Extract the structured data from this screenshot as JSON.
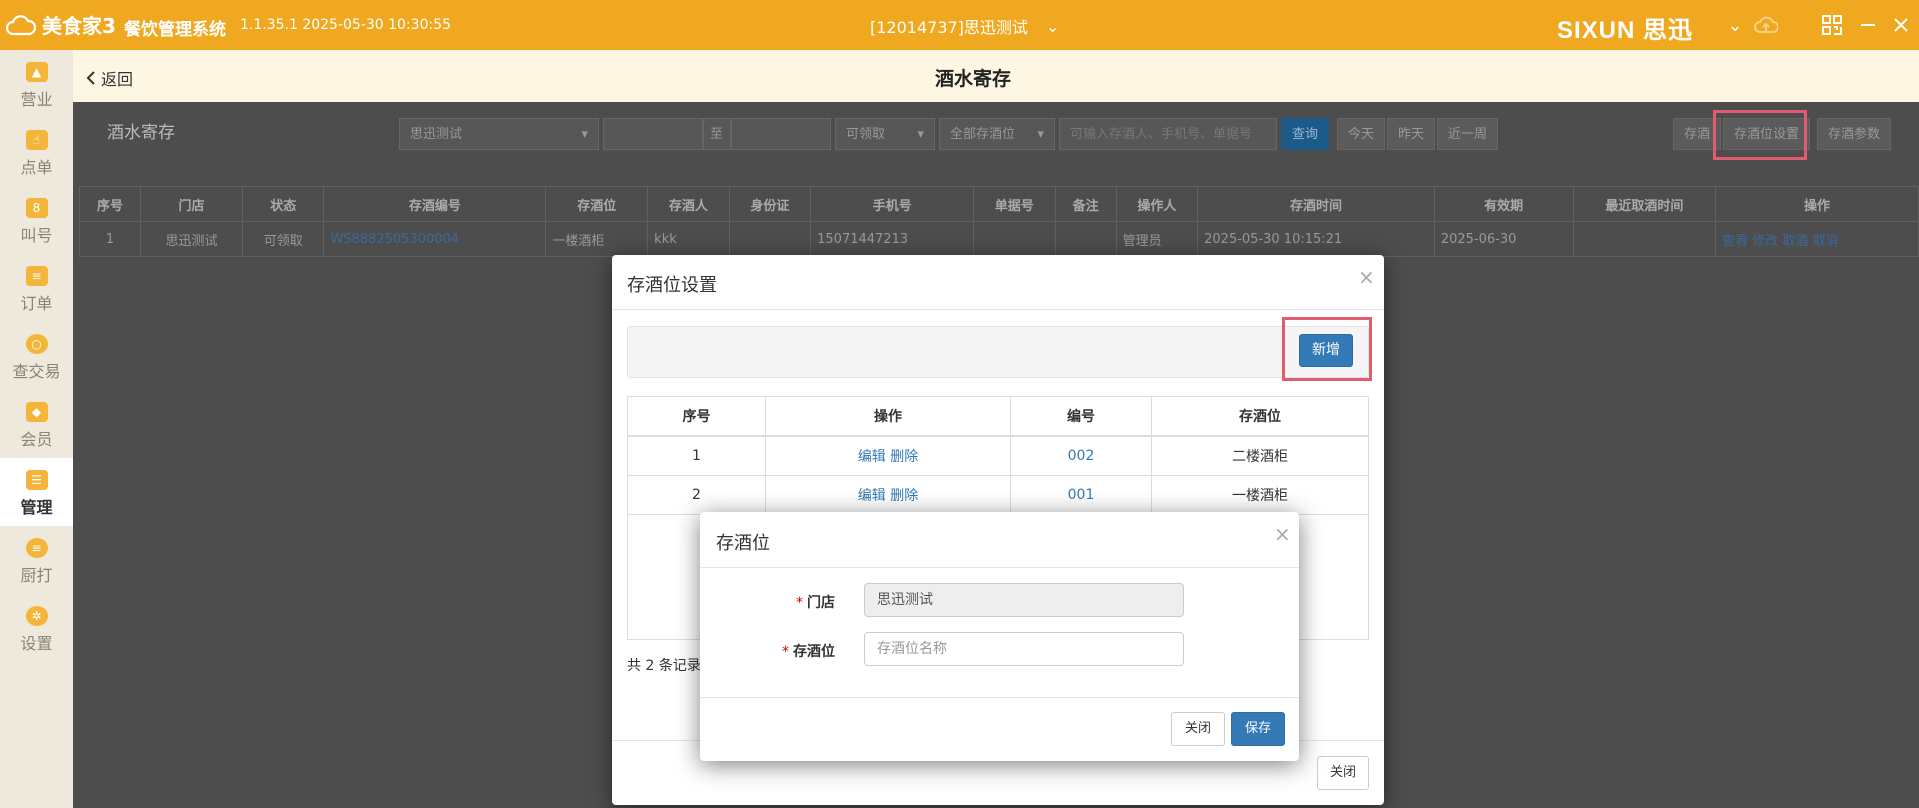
{
  "titlebar": {
    "app_name": "美食家3",
    "system_name": "餐饮管理系统",
    "version": "1.1.35.1 2025-05-30 10:30:55",
    "store": "[12014737]思迅测试",
    "brand": "SIXUN 思迅"
  },
  "sidebar": {
    "items": [
      {
        "label": "营业",
        "icon": "shop-icon"
      },
      {
        "label": "点单",
        "icon": "hand-icon"
      },
      {
        "label": "叫号",
        "icon": "number-icon"
      },
      {
        "label": "订单",
        "icon": "order-icon"
      },
      {
        "label": "查交易",
        "icon": "search-icon"
      },
      {
        "label": "会员",
        "icon": "diamond-icon"
      },
      {
        "label": "管理",
        "icon": "manage-icon"
      },
      {
        "label": "厨打",
        "icon": "kitchen-icon"
      },
      {
        "label": "设置",
        "icon": "gear-icon"
      }
    ],
    "active": "管理"
  },
  "header": {
    "back": "返回",
    "title": "酒水寄存"
  },
  "page": {
    "title": "酒水寄存",
    "store_select": "思迅测试",
    "date_sep": "至",
    "status_select": "可领取",
    "position_select": "全部存酒位",
    "search_placeholder": "可输入存酒人、手机号、单据号",
    "query": "查询",
    "today": "今天",
    "yesterday": "昨天",
    "last_week": "近一周",
    "btn_store": "存酒",
    "btn_position_settings": "存酒位设置",
    "btn_params": "存酒参数"
  },
  "main_table": {
    "headers": [
      "序号",
      "门店",
      "状态",
      "存酒编号",
      "存酒位",
      "存酒人",
      "身份证",
      "手机号",
      "单据号",
      "备注",
      "操作人",
      "存酒时间",
      "有效期",
      "最近取酒时间",
      "操作"
    ],
    "rows": [
      {
        "no": "1",
        "store": "思迅测试",
        "status": "可领取",
        "code": "WS8882505300004",
        "position": "一楼酒柜",
        "person": "kkk",
        "id": "",
        "phone": "15071447213",
        "bill": "",
        "remark": "",
        "operator": "管理员",
        "time": "2025-05-30 10:15:21",
        "expire": "2025-06-30",
        "last_take": "",
        "actions": "查看 修改 取酒 取消"
      }
    ]
  },
  "modal_positions": {
    "title": "存酒位设置",
    "add": "新增",
    "headers": [
      "序号",
      "操作",
      "编号",
      "存酒位"
    ],
    "rows": [
      {
        "no": "1",
        "edit": "编辑",
        "delete": "删除",
        "code": "002",
        "name": "二楼酒柜"
      },
      {
        "no": "2",
        "edit": "编辑",
        "delete": "删除",
        "code": "001",
        "name": "一楼酒柜"
      }
    ],
    "summary": "共 2 条记录",
    "close": "关闭"
  },
  "modal_edit": {
    "title": "存酒位",
    "store_label": "门店",
    "store_value": "思迅测试",
    "position_label": "存酒位",
    "position_placeholder": "存酒位名称",
    "close": "关闭",
    "save": "保存"
  },
  "colors": {
    "accent": "#f0a821",
    "primary": "#337ab7",
    "highlight": "#e05d6f"
  }
}
